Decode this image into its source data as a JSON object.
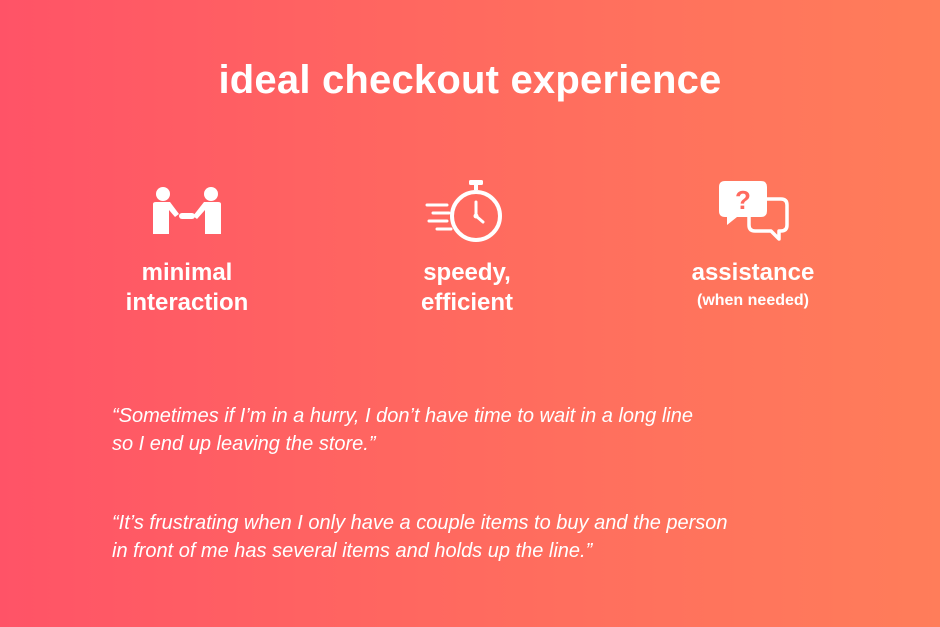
{
  "title": "ideal checkout experience",
  "features": [
    {
      "icon": "handshake-icon",
      "label_line1": "minimal",
      "label_line2": "interaction",
      "sublabel": ""
    },
    {
      "icon": "stopwatch-icon",
      "label_line1": "speedy,",
      "label_line2": "efficient",
      "sublabel": ""
    },
    {
      "icon": "chat-question-icon",
      "label_line1": "assistance",
      "label_line2": "",
      "sublabel": "(when needed)"
    }
  ],
  "quotes": [
    {
      "line1": "“Sometimes if I’m in a hurry, I don’t have time to wait in a long line",
      "line2": "so I end up leaving the store.”"
    },
    {
      "line1": "“It’s frustrating when I only have a couple items to buy and the person",
      "line2": "in front of me has several items and holds up the line.”"
    }
  ],
  "colors": {
    "background_left": "#ff5367",
    "background_right": "#ff7d5a",
    "text": "#ffffff"
  }
}
